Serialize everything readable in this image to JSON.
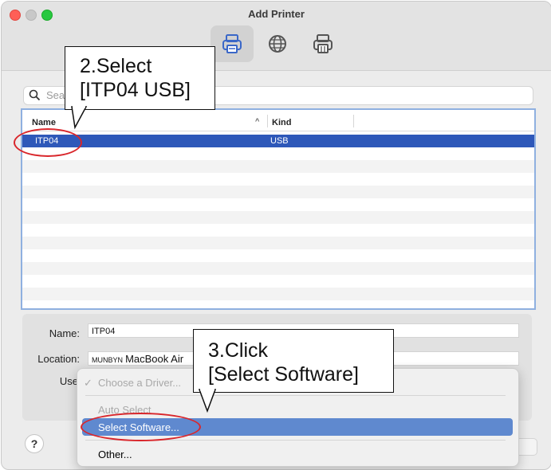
{
  "window": {
    "title": "Add Printer"
  },
  "toolbar": {
    "buttons": [
      {
        "icon": "default-printer-icon",
        "selected": true
      },
      {
        "icon": "ip-globe-icon",
        "selected": false
      },
      {
        "icon": "windows-printer-icon",
        "selected": false
      }
    ]
  },
  "search": {
    "placeholder": "Search",
    "value": ""
  },
  "printer_list": {
    "columns": [
      "Name",
      "Kind"
    ],
    "sort_indicator": "^",
    "rows": [
      {
        "name": "ITP04",
        "kind": "USB",
        "selected": true
      }
    ]
  },
  "details": {
    "name_label": "Name:",
    "name_value": "ITP04",
    "location_label": "Location:",
    "location_value_small": "MUNBYN",
    "location_value": "MacBook Air",
    "use_label": "Use"
  },
  "driver_menu": {
    "items": [
      {
        "label": "Choose a Driver...",
        "checked": true,
        "disabled": true
      },
      {
        "label": "Auto Select",
        "disabled": true
      },
      {
        "label": "Select Software...",
        "highlighted": true
      },
      {
        "label": "Other..."
      }
    ]
  },
  "help_label": "?",
  "annotations": {
    "step2": "2.Select\n[ITP04 USB]",
    "step3": "3.Click\n[Select Software]"
  },
  "colors": {
    "selection": "#2e58b9",
    "menu_highlight": "#5f89cf",
    "annotation_red": "#d9262b"
  }
}
